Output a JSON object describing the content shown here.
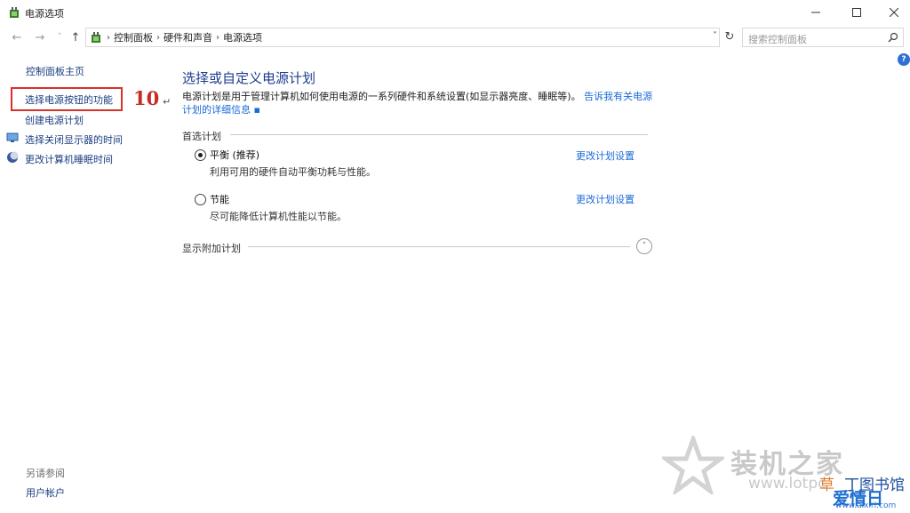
{
  "window": {
    "title": "电源选项",
    "icon": "power-options-icon"
  },
  "nav": {
    "back_icon": "arrow-left-icon",
    "forward_icon": "arrow-right-icon",
    "up_icon": "arrow-up-icon",
    "breadcrumbs": [
      "控制面板",
      "硬件和声音",
      "电源选项"
    ],
    "search_placeholder": "搜索控制面板"
  },
  "sidebar": {
    "home": "控制面板主页",
    "items": [
      {
        "label": "选择电源按钮的功能"
      },
      {
        "label": "创建电源计划"
      },
      {
        "label": "选择关闭显示器的时间"
      },
      {
        "label": "更改计算机睡眠时间"
      }
    ],
    "see_also": "另请参阅",
    "accounts": "用户帐户"
  },
  "annotation": {
    "step": "10",
    "mark": "↵",
    "highlight_color": "#d8312a"
  },
  "main": {
    "title": "选择或自定义电源计划",
    "desc_text": "电源计划是用于管理计算机如何使用电源的一系列硬件和系统设置(如显示器亮度、睡眠等)。",
    "desc_link": "告诉我有关电源计划的详细信息",
    "section_label": "首选计划",
    "plans": [
      {
        "name": "平衡 (推荐)",
        "desc": "利用可用的硬件自动平衡功耗与性能。",
        "selected": true,
        "change_label": "更改计划设置"
      },
      {
        "name": "节能",
        "desc": "尽可能降低计算机性能以节能。",
        "selected": false,
        "change_label": "更改计划设置"
      }
    ],
    "extra_label": "显示附加计划"
  },
  "watermark": {
    "brand": "装机之家",
    "site": "www.lotpc",
    "cao": "草",
    "tushu": "丁图书馆",
    "aiqiri": "爱情日",
    "url": "www.aixiri.com"
  }
}
